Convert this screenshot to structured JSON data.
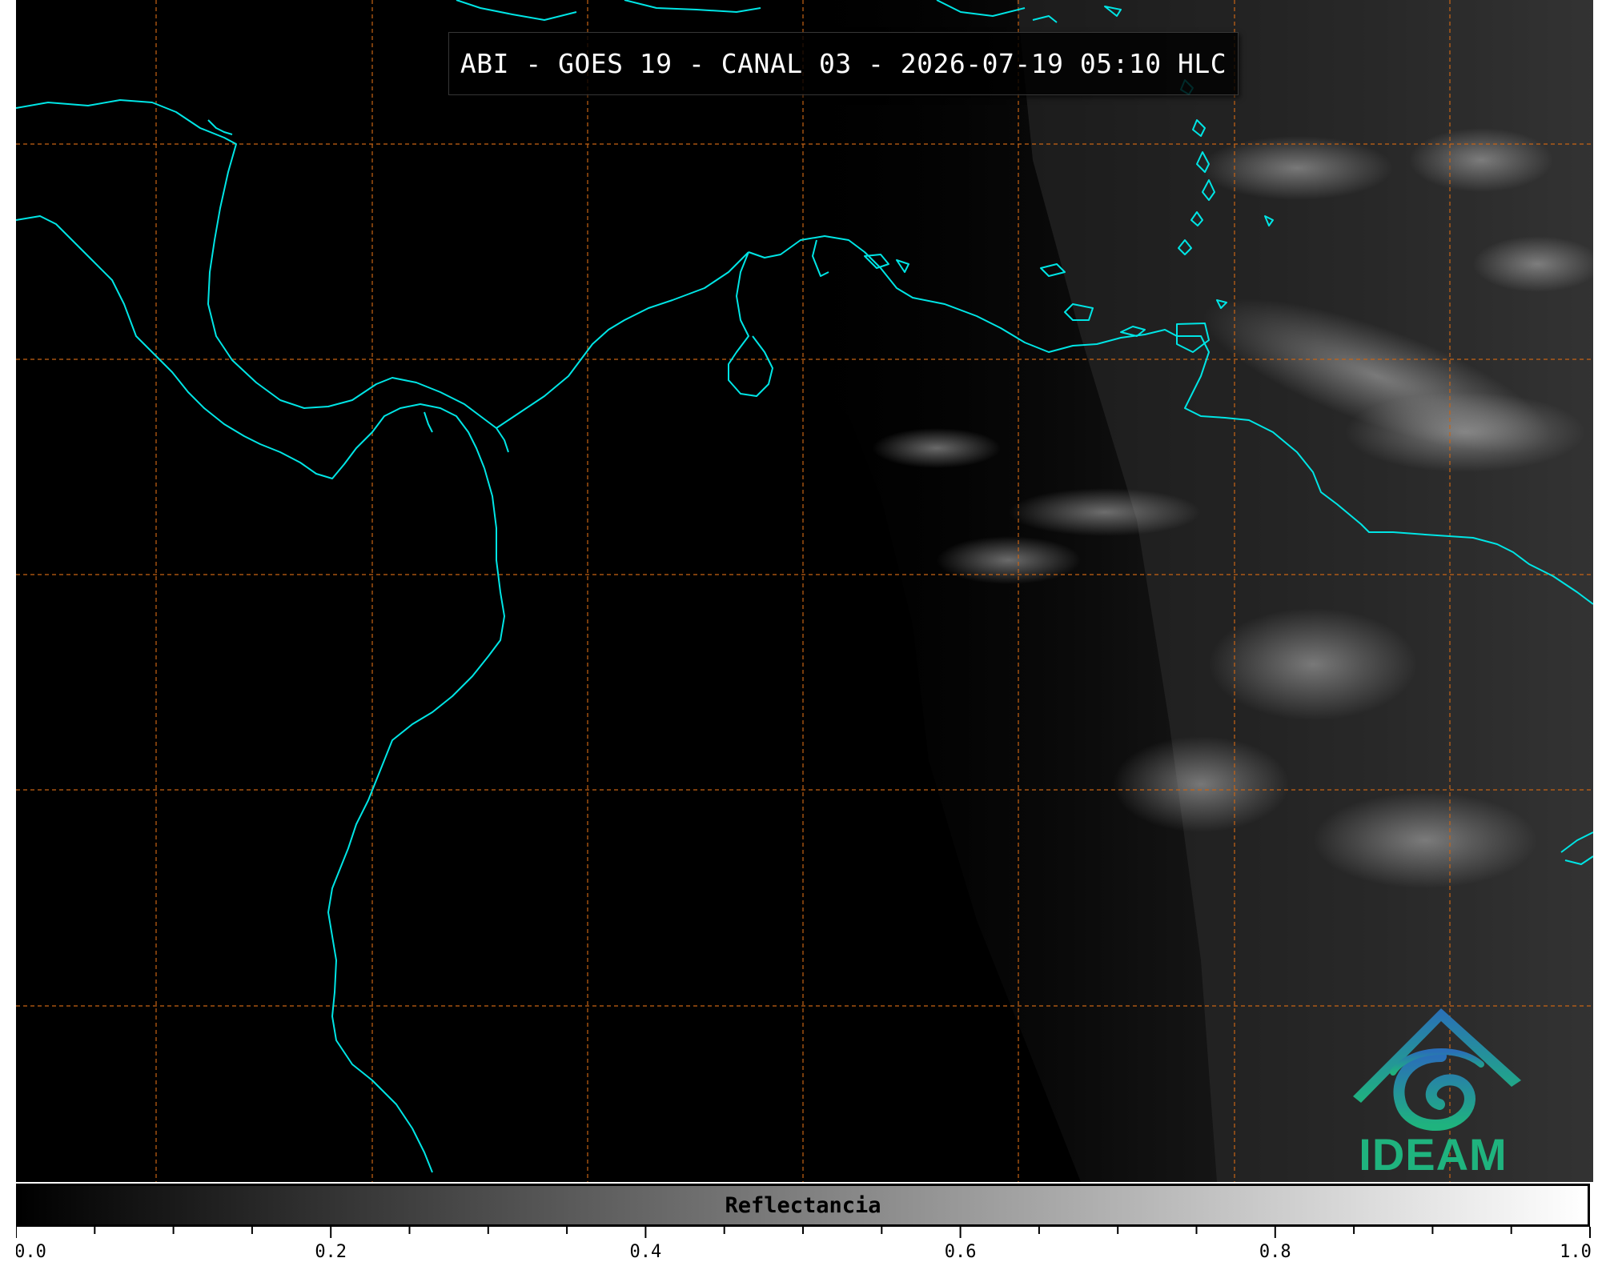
{
  "title": "ABI - GOES 19 - CANAL 03 - 2026-07-19 05:10 HLC",
  "colorbar": {
    "label": "Reflectancia",
    "min": 0.0,
    "max": 1.0,
    "ticks": [
      "0.0",
      "0.2",
      "0.4",
      "0.6",
      "0.8",
      "1.0"
    ],
    "colormap": "grayscale (black to white)"
  },
  "logo": {
    "text": "IDEAM",
    "icon": "ideam-logo-icon"
  },
  "colors": {
    "coastline": "#00e5e5",
    "gridlines": "#c86414",
    "background": "#000000",
    "logo_blue": "#2a6fb8",
    "logo_green": "#1fb37e"
  }
}
